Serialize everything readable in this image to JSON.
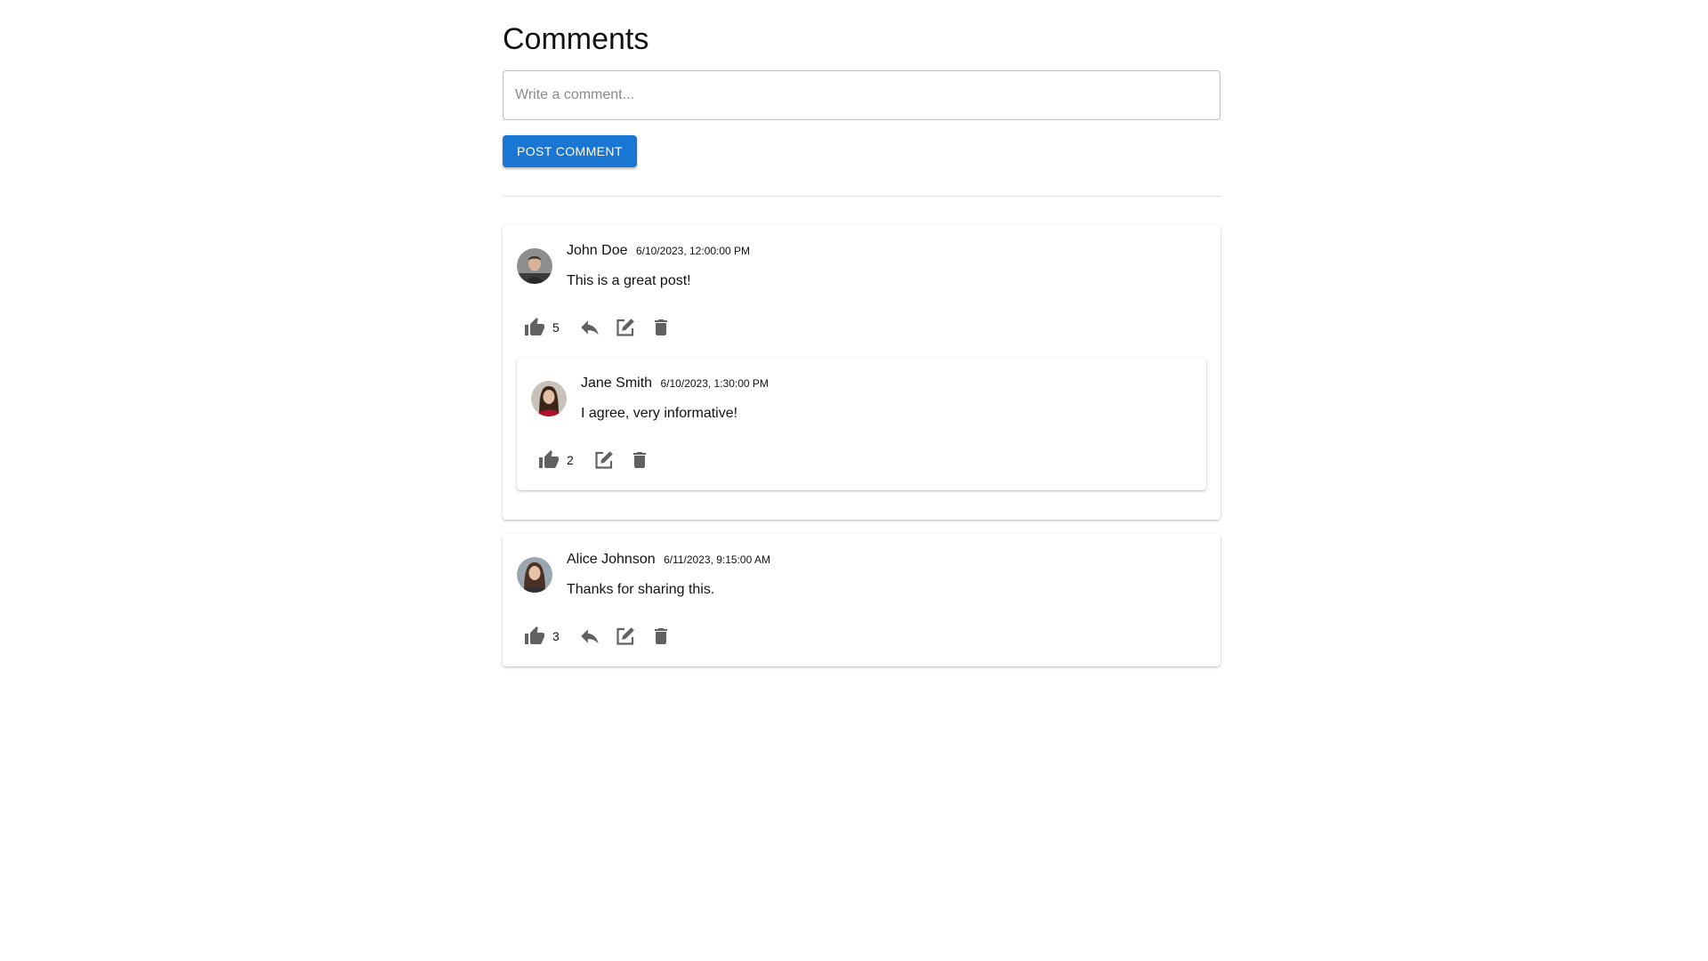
{
  "page": {
    "title": "Comments"
  },
  "composer": {
    "placeholder": "Write a comment...",
    "value": "",
    "post_label": "POST COMMENT"
  },
  "comments": [
    {
      "author": "John Doe",
      "timestamp": "6/10/2023, 12:00:00 PM",
      "text": "This is a great post!",
      "likes": "5",
      "avatar": "man-photo-avatar",
      "actions": [
        "like-icon",
        "reply-icon",
        "edit-icon",
        "delete-icon"
      ],
      "replies": [
        {
          "author": "Jane Smith",
          "timestamp": "6/10/2023, 1:30:00 PM",
          "text": "I agree, very informative!",
          "likes": "2",
          "avatar": "woman-photo-avatar",
          "actions": [
            "like-icon",
            "edit-icon",
            "delete-icon"
          ]
        }
      ]
    },
    {
      "author": "Alice Johnson",
      "timestamp": "6/11/2023, 9:15:00 AM",
      "text": "Thanks for sharing this.",
      "likes": "3",
      "avatar": "woman-photo-avatar",
      "actions": [
        "like-icon",
        "reply-icon",
        "edit-icon",
        "delete-icon"
      ],
      "replies": []
    }
  ],
  "colors": {
    "primary": "#1976d2",
    "icon": "#616161",
    "divider": "#e0e0e0"
  }
}
